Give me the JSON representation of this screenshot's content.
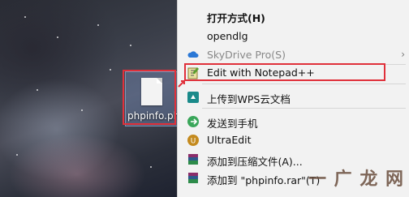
{
  "desktop": {
    "file_name": "phpinfo.php"
  },
  "menu": {
    "items": [
      {
        "label": "打开方式(H)",
        "bold": true
      },
      {
        "label": "opendlg"
      },
      {
        "label": "SkyDrive Pro(S)",
        "disabled": true,
        "submenu": true
      },
      {
        "label": "Edit with Notepad++"
      },
      {
        "label": "上传到WPS云文档"
      },
      {
        "label": "发送到手机"
      },
      {
        "label": "UltraEdit"
      },
      {
        "label": "添加到压缩文件(A)..."
      },
      {
        "label": "添加到 \"phpinfo.rar\"(T)"
      }
    ],
    "submenu_arrow": "›"
  },
  "watermark": "一 广 龙 网",
  "colors": {
    "highlight": "#e0303a",
    "menu_bg": "#f2f2f2"
  }
}
